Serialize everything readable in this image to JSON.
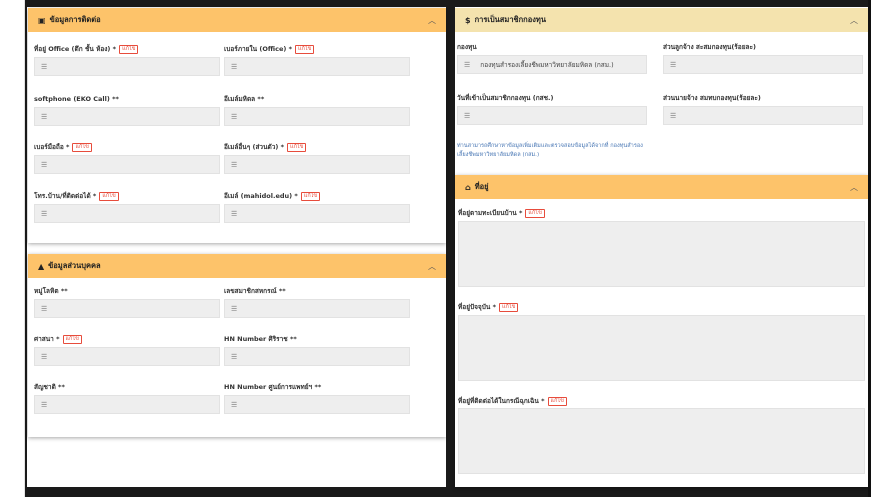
{
  "contact": {
    "title": "ข้อมูลการติดต่อ",
    "edit_label": "แก้ไข",
    "fields": [
      {
        "label": "ที่อยู่ Office (ตึก ชั้น ห้อง) *",
        "editable": true
      },
      {
        "label": "เบอร์ภายใน (Office) *",
        "editable": true
      },
      {
        "label": "softphone (EKO Call) **",
        "editable": false
      },
      {
        "label": "อีเมล์มหิดล **",
        "editable": false
      },
      {
        "label": "เบอร์มือถือ *",
        "editable": true
      },
      {
        "label": "อีเมล์อื่นๆ (ส่วนตัว) *",
        "editable": true
      },
      {
        "label": "โทร.บ้าน/ที่ติดต่อได้ *",
        "editable": true
      },
      {
        "label": "อีเมล์ (mahidol.edu) *",
        "editable": true
      }
    ]
  },
  "personal": {
    "title": "ข้อมูลส่วนบุคคล",
    "edit_label": "แก้ไข",
    "fields": [
      {
        "label": "หมู่โลหิต **",
        "editable": false
      },
      {
        "label": "เลขสมาชิกสหกรณ์ **",
        "editable": false
      },
      {
        "label": "ศาสนา *",
        "editable": true
      },
      {
        "label": "HN Number ศิริราช **",
        "editable": false
      },
      {
        "label": "สัญชาติ **",
        "editable": false
      },
      {
        "label": "HN Number ศูนย์การแพทย์ฯ **",
        "editable": false
      }
    ]
  },
  "fund": {
    "title": "การเป็นสมาชิกกองทุน",
    "fields": [
      {
        "label": "กองทุน",
        "value": "กองทุนสำรองเลี้ยงชีพมหาวิทยาลัยมหิดล (กสม.)"
      },
      {
        "label": "ส่วนลูกจ้าง สะสมกองทุน(ร้อยละ)",
        "value": ""
      },
      {
        "label": "วันที่เข้าเป็นสมาชิกกองทุน (กสช.)",
        "value": ""
      },
      {
        "label": "ส่วนนายจ้าง สมทบกองทุน(ร้อยละ)",
        "value": ""
      }
    ],
    "note_line1": "ท่านสามารถศึกษาหาข้อมูลเพิ่มเติมและตรวจสอบข้อมูลได้จากที่ กองทุนสำรอง",
    "note_line2": "เลี้ยงชีพมหาวิทยาลัยมหิดล (กสม.)"
  },
  "address": {
    "title": "ที่อยู่",
    "edit_label": "แก้ไข",
    "fields": [
      {
        "label": "ที่อยู่ตามทะเบียนบ้าน *"
      },
      {
        "label": "ที่อยู่ปัจจุบัน *"
      },
      {
        "label": "ที่อยู่ที่ติดต่อได้ในกรณีฉุกเฉิน *"
      }
    ]
  }
}
